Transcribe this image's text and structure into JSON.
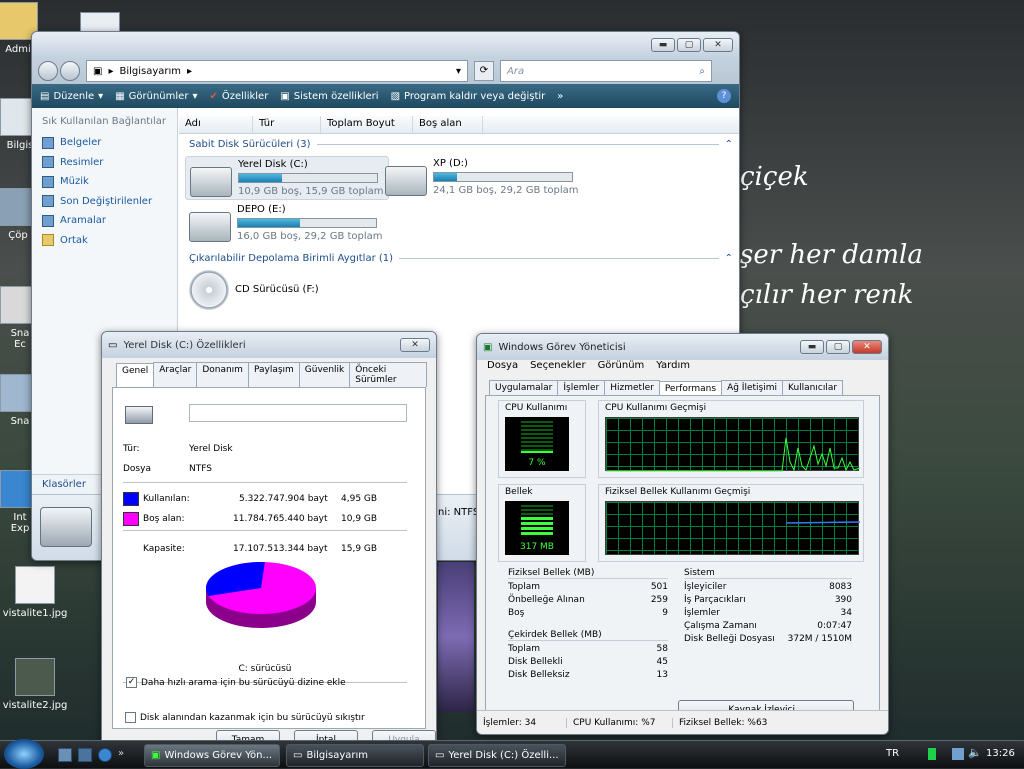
{
  "desktop": {
    "poem": [
      "çiçek",
      "şer her damla",
      "çılır her renk"
    ],
    "icons": [
      {
        "label": "Admi"
      },
      {
        "label": "Bilgis"
      },
      {
        "label": "Çöp"
      },
      {
        "label": "Sna\nEc"
      },
      {
        "label": "Sna"
      },
      {
        "label": "Int\nExp"
      },
      {
        "label": "vistalite1.jpg"
      },
      {
        "label": "vistalite2.jpg"
      }
    ]
  },
  "explorer": {
    "breadcrumb": "Bilgisayarım",
    "search_placeholder": "Ara",
    "toolbar": {
      "organize": "Düzenle",
      "views": "Görünümler",
      "properties": "Özellikler",
      "system_properties": "Sistem özellikleri",
      "uninstall": "Program kaldır veya değiştir"
    },
    "favorites_header": "Sık Kullanılan Bağlantılar",
    "favorites": [
      "Belgeler",
      "Resimler",
      "Müzik",
      "Son Değiştirilenler",
      "Aramalar",
      "Ortak"
    ],
    "folders_label": "Klasörler",
    "columns": [
      "Adı",
      "Tür",
      "Toplam Boyut",
      "Boş alan"
    ],
    "group_fixed": "Sabit Disk Sürücüleri (3)",
    "group_removable": "Çıkarılabilir Depolama Birimli Aygıtlar (1)",
    "drives": [
      {
        "name": "Yerel Disk (C:)",
        "info": "10,9 GB boş, 15,9 GB toplam",
        "used_fraction": 0.31
      },
      {
        "name": "XP (D:)",
        "info": "24,1 GB boş, 29,2 GB toplam",
        "used_fraction": 0.17
      },
      {
        "name": "DEPO (E:)",
        "info": "16,0 GB boş, 29,2 GB toplam",
        "used_fraction": 0.45
      }
    ],
    "cd_drive": "CD Sürücüsü (F:)",
    "details_fragment": "ni: NTFS"
  },
  "properties": {
    "title": "Yerel Disk (C:) Özellikleri",
    "tabs": [
      "Genel",
      "Araçlar",
      "Donanım",
      "Paylaşım",
      "Güvenlik",
      "Önceki Sürümler"
    ],
    "type_label": "Tür:",
    "type_value": "Yerel Disk",
    "fs_label": "Dosya",
    "fs_value": "NTFS",
    "used_label": "Kullanılan:",
    "used_bytes": "5.322.747.904 bayt",
    "used_gb": "4,95 GB",
    "free_label": "Boş alan:",
    "free_bytes": "11.784.765.440 bayt",
    "free_gb": "10,9 GB",
    "capacity_label": "Kapasite:",
    "capacity_bytes": "17.107.513.344 bayt",
    "capacity_gb": "15,9 GB",
    "drive_label": "C: sürücüsü",
    "compress_label": "Disk alanından kazanmak için bu sürücüyü sıkıştır",
    "index_label": "Daha hızlı arama için bu sürücüyü dizine ekle",
    "ok": "Tamam",
    "cancel": "İptal",
    "apply": "Uygula",
    "used_color": "#0000ff",
    "free_color": "#ff00ff"
  },
  "taskmgr": {
    "title": "Windows Görev Yöneticisi",
    "menu": [
      "Dosya",
      "Seçenekler",
      "Görünüm",
      "Yardım"
    ],
    "tabs": [
      "Uygulamalar",
      "İşlemler",
      "Hizmetler",
      "Performans",
      "Ağ İletişimi",
      "Kullanıcılar"
    ],
    "cpu_usage_label": "CPU Kullanımı",
    "cpu_value": "7 %",
    "cpu_history_label": "CPU Kullanımı Geçmişi",
    "mem_label": "Bellek",
    "mem_value": "317 MB",
    "mem_history_label": "Fiziksel Bellek Kullanımı Geçmişi",
    "physical_title": "Fiziksel Bellek (MB)",
    "physical": [
      {
        "k": "Toplam",
        "v": "501"
      },
      {
        "k": "Önbelleğe Alınan",
        "v": "259"
      },
      {
        "k": "Boş",
        "v": "9"
      }
    ],
    "kernel_title": "Çekirdek Bellek (MB)",
    "kernel": [
      {
        "k": "Toplam",
        "v": "58"
      },
      {
        "k": "Disk Bellekli",
        "v": "45"
      },
      {
        "k": "Disk Belleksiz",
        "v": "13"
      }
    ],
    "system_title": "Sistem",
    "system": [
      {
        "k": "İşleyiciler",
        "v": "8083"
      },
      {
        "k": "İş Parçacıkları",
        "v": "390"
      },
      {
        "k": "İşlemler",
        "v": "34"
      },
      {
        "k": "Çalışma Zamanı",
        "v": "0:07:47"
      },
      {
        "k": "Disk Belleği Dosyası",
        "v": "372M / 1510M"
      }
    ],
    "resource_monitor": "Kaynak İzleyici...",
    "status_processes": "İşlemler: 34",
    "status_cpu": "CPU Kullanımı: %7",
    "status_mem": "Fiziksel Bellek: %63",
    "cpu_fraction": 0.07,
    "mem_fraction": 0.63
  },
  "taskbar": {
    "buttons": [
      "Windows Görev Yön...",
      "Bilgisayarım",
      "Yerel Disk (C:) Özelli..."
    ],
    "lang": "TR",
    "clock": "13:26"
  }
}
